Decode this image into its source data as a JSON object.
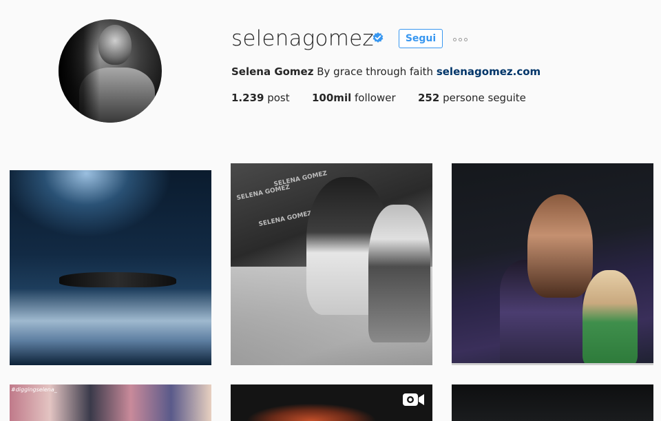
{
  "profile": {
    "username": "selenagomez",
    "verified": true,
    "follow_label": "Segui",
    "more_label": "Altre opzioni",
    "full_name": "Selena Gomez",
    "bio_text": "By grace through faith",
    "website": "selenagomez.com",
    "stats": {
      "posts_count": "1.239",
      "posts_label": "post",
      "followers_count": "100mil",
      "followers_label": "follower",
      "following_count": "252",
      "following_label": "persone seguite"
    }
  },
  "grid": {
    "tile4_caption": "#diggingselena_",
    "tile2_wall_text": "SELENA GOMEZ"
  },
  "colors": {
    "accent": "#3897f0",
    "link": "#003569",
    "text": "#262626",
    "background": "#fafafa"
  },
  "icons": {
    "verified": "verified-badge-icon",
    "more": "ellipsis-icon",
    "video": "video-camera-icon"
  }
}
